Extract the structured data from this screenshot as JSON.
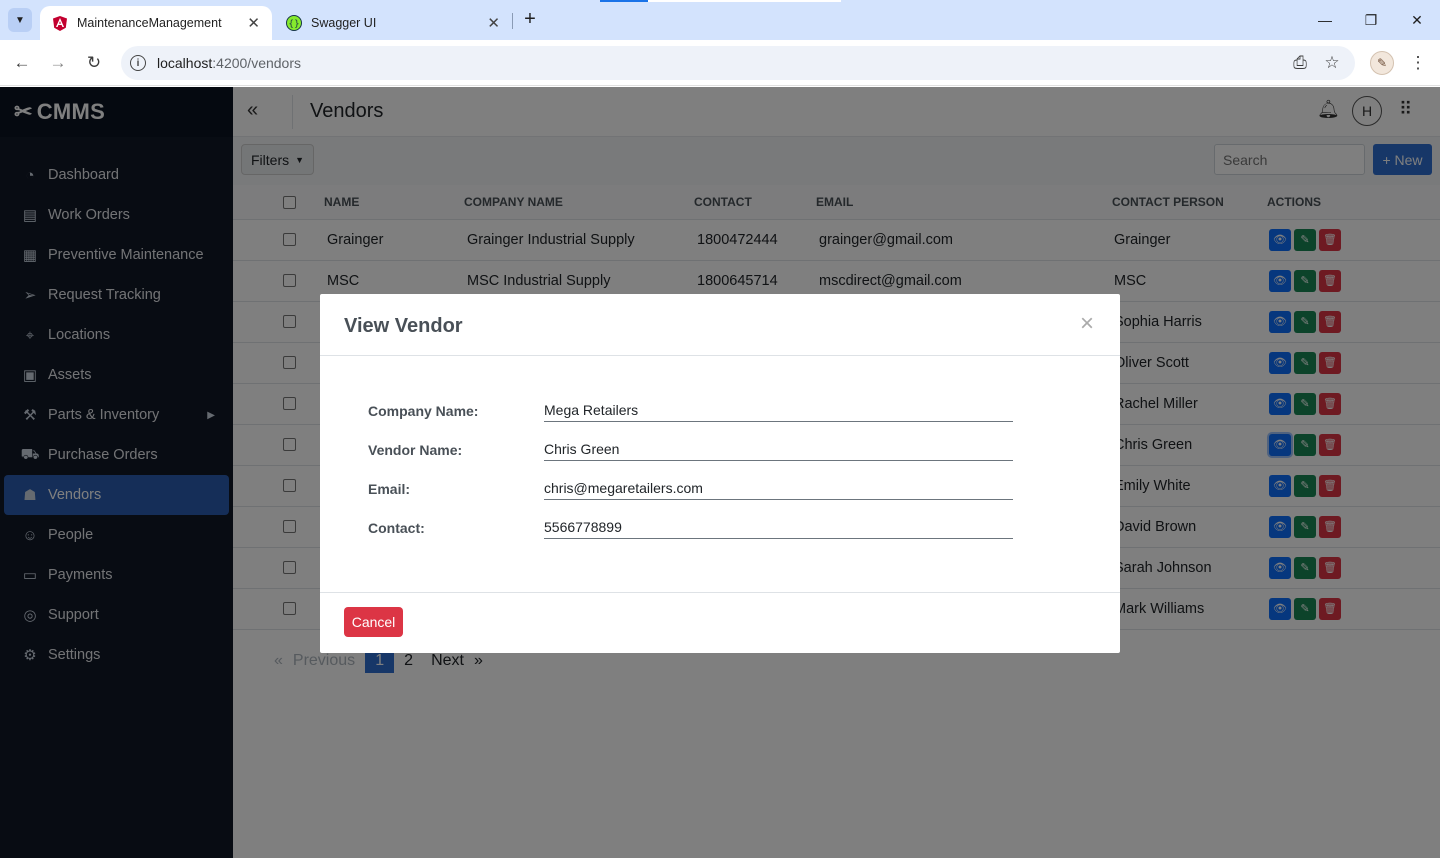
{
  "browser": {
    "tabs": [
      {
        "title": "MaintenanceManagement",
        "favicon": "angular-icon",
        "active": true
      },
      {
        "title": "Swagger UI",
        "favicon": "swagger-icon",
        "active": false
      }
    ],
    "address": {
      "host": "localhost",
      "path": ":4200/vendors"
    }
  },
  "app": {
    "brand": "CMMS",
    "nav": [
      {
        "label": "Dashboard",
        "icon": "dashboard-icon"
      },
      {
        "label": "Work Orders",
        "icon": "clipboard-icon"
      },
      {
        "label": "Preventive Maintenance",
        "icon": "calendar-icon"
      },
      {
        "label": "Request Tracking",
        "icon": "send-icon"
      },
      {
        "label": "Locations",
        "icon": "location-pin-icon"
      },
      {
        "label": "Assets",
        "icon": "boxes-icon"
      },
      {
        "label": "Parts & Inventory",
        "icon": "tools-icon"
      },
      {
        "label": "Purchase Orders",
        "icon": "cart-icon"
      },
      {
        "label": "Vendors",
        "icon": "vendors-icon",
        "active": true
      },
      {
        "label": "People",
        "icon": "people-icon"
      },
      {
        "label": "Payments",
        "icon": "credit-card-icon"
      },
      {
        "label": "Support",
        "icon": "lifebuoy-icon"
      },
      {
        "label": "Settings",
        "icon": "gear-icon"
      }
    ],
    "page_title": "Vendors",
    "avatar_initial": "H",
    "filters_label": "Filters",
    "search_placeholder": "Search",
    "new_label": "+ New"
  },
  "table": {
    "headers": [
      "NAME",
      "COMPANY NAME",
      "CONTACT",
      "EMAIL",
      "CONTACT PERSON",
      "ACTIONS"
    ],
    "rows": [
      {
        "name": "Grainger",
        "company": "Grainger Industrial Supply",
        "contact": "1800472444",
        "email": "grainger@gmail.com",
        "person": "Grainger"
      },
      {
        "name": "MSC",
        "company": "MSC Industrial Supply",
        "contact": "1800645714",
        "email": "mscdirect@gmail.com",
        "person": "MSC"
      },
      {
        "name": "",
        "company": "",
        "contact": "",
        "email": "",
        "person": "Sophia Harris"
      },
      {
        "name": "",
        "company": "",
        "contact": "",
        "email": "",
        "person": "Oliver Scott"
      },
      {
        "name": "",
        "company": "",
        "contact": "",
        "email": "",
        "person": "Rachel Miller"
      },
      {
        "name": "",
        "company": "",
        "contact": "",
        "email": "",
        "person": "Chris Green"
      },
      {
        "name": "",
        "company": "",
        "contact": "",
        "email": "",
        "person": "Emily White"
      },
      {
        "name": "",
        "company": "",
        "contact": "",
        "email": "",
        "person": "David Brown"
      },
      {
        "name": "",
        "company": "",
        "contact": "",
        "email": "",
        "person": "Sarah Johnson"
      },
      {
        "name": "",
        "company": "",
        "contact": "",
        "email": "",
        "person": "Mark Williams"
      }
    ]
  },
  "pagination": {
    "first": "«",
    "previous": "Previous",
    "current": "1",
    "page2": "2",
    "next": "Next",
    "last": "»"
  },
  "modal": {
    "title": "View Vendor",
    "close": "×",
    "fields": [
      {
        "label": "Company Name:",
        "value": "Mega Retailers"
      },
      {
        "label": "Vendor Name:",
        "value": "Chris Green"
      },
      {
        "label": "Email:",
        "value": "chris@megaretailers.com"
      },
      {
        "label": "Contact:",
        "value": "5566778899"
      }
    ],
    "cancel_label": "Cancel"
  },
  "colors": {
    "accent": "#2f6fd0",
    "sidebar": "#111827",
    "view": "#0d6efd",
    "edit": "#198754",
    "delete": "#dc3545"
  }
}
